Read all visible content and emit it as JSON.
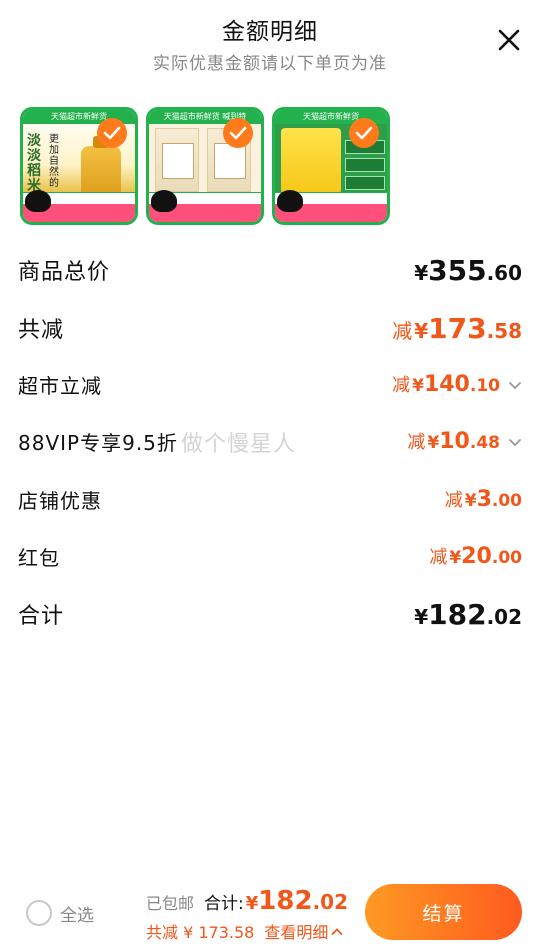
{
  "header": {
    "title": "金额明细",
    "subtitle": "实际优惠金额请以下单页为准",
    "close_icon": "close-icon"
  },
  "products": [
    {
      "banner": "天猫超市新鲜货",
      "name": "rice-oil",
      "selected": true
    },
    {
      "banner": "天猫超市新鲜货 喊到特",
      "name": "rice-bags",
      "selected": true
    },
    {
      "banner": "天猫超市新鲜货",
      "name": "chicken-essence",
      "selected": true
    }
  ],
  "rows": [
    {
      "label": "商品总价",
      "prefix": "",
      "currency": "¥",
      "int": "355",
      "dec": ".60",
      "color": "black",
      "chevron": false
    },
    {
      "label": "共减",
      "prefix": "减",
      "currency": "¥",
      "int": "173",
      "dec": ".58",
      "color": "orange",
      "chevron": false
    },
    {
      "label": "超市立减",
      "prefix": "减",
      "currency": "¥",
      "int": "140",
      "dec": ".10",
      "color": "orange",
      "chevron": true
    },
    {
      "label": "88VIP专享9.5折",
      "prefix": "减",
      "currency": "¥",
      "int": "10",
      "dec": ".48",
      "color": "orange",
      "chevron": true
    },
    {
      "label": "店铺优惠",
      "prefix": "减",
      "currency": "¥",
      "int": "3",
      "dec": ".00",
      "color": "orange",
      "chevron": false
    },
    {
      "label": "红包",
      "prefix": "减",
      "currency": "¥",
      "int": "20",
      "dec": ".00",
      "color": "orange",
      "chevron": false
    },
    {
      "label": "合计",
      "prefix": "",
      "currency": "¥",
      "int": "182",
      "dec": ".02",
      "color": "black",
      "chevron": false
    }
  ],
  "watermark": "做个慢星人",
  "footer": {
    "select_all": "全选",
    "shipping": "已包邮",
    "total_label": "合计:",
    "total_currency": "¥",
    "total_int": "182",
    "total_dec": ".02",
    "saved": "共减 ¥ 173.58",
    "details": "查看明细",
    "checkout": "结算"
  },
  "colors": {
    "accent": "#f2571a",
    "checkout_start": "#ff9a23",
    "checkout_end": "#ff5a1e"
  }
}
